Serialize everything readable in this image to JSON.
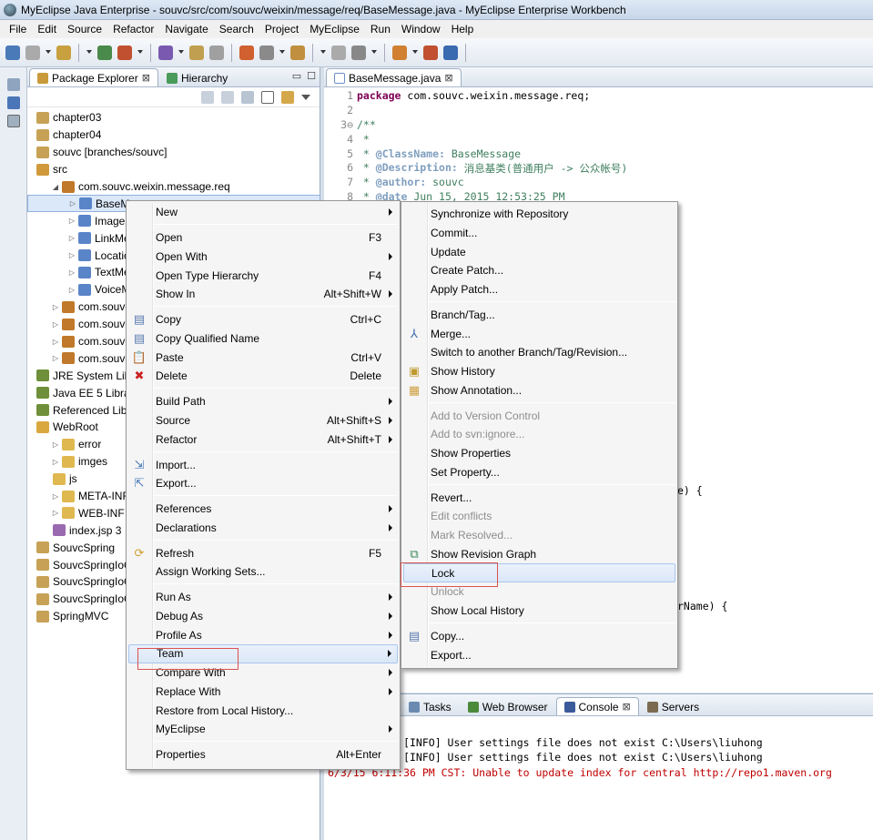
{
  "window": {
    "title": "MyEclipse Java Enterprise - souvc/src/com/souvc/weixin/message/req/BaseMessage.java - MyEclipse Enterprise Workbench"
  },
  "menubar": [
    "File",
    "Edit",
    "Source",
    "Refactor",
    "Navigate",
    "Search",
    "Project",
    "MyEclipse",
    "Run",
    "Window",
    "Help"
  ],
  "views": {
    "package_explorer_tab": "Package Explorer",
    "hierarchy_tab": "Hierarchy",
    "close_glyph": "⊠",
    "minimize_glyph": "▭",
    "maximize_glyph": "☐"
  },
  "tree": [
    {
      "indent": 0,
      "twisty": "",
      "icon": "project",
      "label": "chapter03"
    },
    {
      "indent": 0,
      "twisty": "",
      "icon": "project",
      "label": "chapter04"
    },
    {
      "indent": 0,
      "twisty": "",
      "icon": "project",
      "label": "souvc [branches/souvc]"
    },
    {
      "indent": 0,
      "twisty": "",
      "icon": "src-folder",
      "label": "src"
    },
    {
      "indent": 1,
      "twisty": "◢",
      "icon": "package",
      "label": "com.souvc.weixin.message.req"
    },
    {
      "indent": 2,
      "twisty": "▷",
      "icon": "java-file",
      "label": "BaseMe",
      "selected": true
    },
    {
      "indent": 2,
      "twisty": "▷",
      "icon": "java-file",
      "label": "ImageM"
    },
    {
      "indent": 2,
      "twisty": "▷",
      "icon": "java-file",
      "label": "LinkMes"
    },
    {
      "indent": 2,
      "twisty": "▷",
      "icon": "java-file",
      "label": "Location"
    },
    {
      "indent": 2,
      "twisty": "▷",
      "icon": "java-file",
      "label": "TextMes"
    },
    {
      "indent": 2,
      "twisty": "▷",
      "icon": "java-file",
      "label": "VoiceMe"
    },
    {
      "indent": 1,
      "twisty": "▷",
      "icon": "package",
      "label": "com.souvc.w"
    },
    {
      "indent": 1,
      "twisty": "▷",
      "icon": "package",
      "label": "com.souvc.w"
    },
    {
      "indent": 1,
      "twisty": "▷",
      "icon": "package",
      "label": "com.souvc.w"
    },
    {
      "indent": 1,
      "twisty": "▷",
      "icon": "package",
      "label": "com.souvc.w"
    },
    {
      "indent": 0,
      "twisty": "",
      "icon": "library",
      "label": "JRE System Lib"
    },
    {
      "indent": 0,
      "twisty": "",
      "icon": "library",
      "label": "Java EE 5 Libra"
    },
    {
      "indent": 0,
      "twisty": "",
      "icon": "library",
      "label": "Referenced Lib"
    },
    {
      "indent": 0,
      "twisty": "",
      "icon": "webroot-folder",
      "label": "WebRoot"
    },
    {
      "indent": 1,
      "twisty": "▷",
      "icon": "folder",
      "label": "error"
    },
    {
      "indent": 1,
      "twisty": "▷",
      "icon": "folder",
      "label": "imges"
    },
    {
      "indent": 1,
      "twisty": "",
      "icon": "folder",
      "label": "js"
    },
    {
      "indent": 1,
      "twisty": "▷",
      "icon": "folder",
      "label": "META-INF"
    },
    {
      "indent": 1,
      "twisty": "▷",
      "icon": "folder",
      "label": "WEB-INF"
    },
    {
      "indent": 1,
      "twisty": "",
      "icon": "jsp-file",
      "label": "index.jsp 3"
    },
    {
      "indent": 0,
      "twisty": "",
      "icon": "project",
      "label": "SouvcSpring"
    },
    {
      "indent": 0,
      "twisty": "",
      "icon": "project",
      "label": "SouvcSpringIoC"
    },
    {
      "indent": 0,
      "twisty": "",
      "icon": "project",
      "label": "SouvcSpringIoC_0"
    },
    {
      "indent": 0,
      "twisty": "",
      "icon": "project",
      "label": "SouvcSpringIoC_D"
    },
    {
      "indent": 0,
      "twisty": "",
      "icon": "project",
      "label": "SpringMVC"
    }
  ],
  "editor": {
    "tab": "BaseMessage.java",
    "lines": [
      {
        "n": "1",
        "parts": [
          {
            "c": "kw",
            "t": "package"
          },
          {
            "c": "ct",
            "t": " com.souvc.weixin.message.req;"
          }
        ]
      },
      {
        "n": "2",
        "parts": []
      },
      {
        "n": "3⊖",
        "parts": [
          {
            "c": "cm",
            "t": "/**"
          }
        ]
      },
      {
        "n": "4",
        "parts": [
          {
            "c": "cm",
            "t": " *"
          }
        ]
      },
      {
        "n": "5",
        "parts": [
          {
            "c": "cm",
            "t": " * "
          },
          {
            "c": "tag",
            "t": "@ClassName:"
          },
          {
            "c": "cm",
            "t": " BaseMessage"
          }
        ]
      },
      {
        "n": "6",
        "parts": [
          {
            "c": "cm",
            "t": " * "
          },
          {
            "c": "tag",
            "t": "@Description:"
          },
          {
            "c": "cm",
            "t": " 消息基类(普通用户 -> 公众帐号)"
          }
        ]
      },
      {
        "n": "7",
        "parts": [
          {
            "c": "cm",
            "t": " * "
          },
          {
            "c": "tag",
            "t": "@author:"
          },
          {
            "c": "cm",
            "t": " souvc"
          }
        ]
      },
      {
        "n": "8",
        "parts": [
          {
            "c": "cm",
            "t": " * "
          },
          {
            "c": "tag",
            "t": "@date"
          },
          {
            "c": "cm",
            "t": " Jun 15, 2015 12:53:25 PM"
          }
        ]
      }
    ],
    "fragment_1": "e) {",
    "fragment_2": "rName) {"
  },
  "console": {
    "tabs": [
      "Tasks",
      "Web Browser",
      "Console",
      "Servers"
    ],
    "lines": [
      {
        "type": "info",
        "text": ":32 PM CST: [INFO] User settings file does not exist C:\\Users\\liuhong"
      },
      {
        "type": "info",
        "text": ":33 PM CST: [INFO] User settings file does not exist C:\\Users\\liuhong"
      },
      {
        "type": "err",
        "text": "6/3/15 6:11:36 PM CST: Unable to update index for central http://repo1.maven.org"
      }
    ]
  },
  "context_menu": [
    {
      "label": "New",
      "submenu": true
    },
    {
      "sep": true
    },
    {
      "label": "Open",
      "shortcut": "F3"
    },
    {
      "label": "Open With",
      "submenu": true
    },
    {
      "label": "Open Type Hierarchy",
      "shortcut": "F4"
    },
    {
      "label": "Show In",
      "shortcut": "Alt+Shift+W",
      "submenu": true
    },
    {
      "sep": true
    },
    {
      "label": "Copy",
      "shortcut": "Ctrl+C",
      "icon": "copy-icon"
    },
    {
      "label": "Copy Qualified Name",
      "icon": "copy-qualified-icon"
    },
    {
      "label": "Paste",
      "shortcut": "Ctrl+V",
      "icon": "paste-icon"
    },
    {
      "label": "Delete",
      "shortcut": "Delete",
      "icon": "delete-icon"
    },
    {
      "sep": true
    },
    {
      "label": "Build Path",
      "submenu": true
    },
    {
      "label": "Source",
      "shortcut": "Alt+Shift+S",
      "submenu": true
    },
    {
      "label": "Refactor",
      "shortcut": "Alt+Shift+T",
      "submenu": true
    },
    {
      "sep": true
    },
    {
      "label": "Import...",
      "icon": "import-icon"
    },
    {
      "label": "Export...",
      "icon": "export-icon"
    },
    {
      "sep": true
    },
    {
      "label": "References",
      "submenu": true
    },
    {
      "label": "Declarations",
      "submenu": true
    },
    {
      "sep": true
    },
    {
      "label": "Refresh",
      "shortcut": "F5",
      "icon": "refresh-icon"
    },
    {
      "label": "Assign Working Sets..."
    },
    {
      "sep": true
    },
    {
      "label": "Run As",
      "submenu": true
    },
    {
      "label": "Debug As",
      "submenu": true
    },
    {
      "label": "Profile As",
      "submenu": true
    },
    {
      "label": "Team",
      "submenu": true,
      "hover": true
    },
    {
      "label": "Compare With",
      "submenu": true
    },
    {
      "label": "Replace With",
      "submenu": true
    },
    {
      "label": "Restore from Local History..."
    },
    {
      "label": "MyEclipse",
      "submenu": true
    },
    {
      "sep": true
    },
    {
      "label": "Properties",
      "shortcut": "Alt+Enter"
    }
  ],
  "team_menu": [
    {
      "label": "Synchronize with Repository"
    },
    {
      "label": "Commit..."
    },
    {
      "label": "Update"
    },
    {
      "label": "Create Patch..."
    },
    {
      "label": "Apply Patch..."
    },
    {
      "sep": true
    },
    {
      "label": "Branch/Tag..."
    },
    {
      "label": "Merge...",
      "icon": "merge-icon"
    },
    {
      "label": "Switch to another Branch/Tag/Revision..."
    },
    {
      "label": "Show History",
      "icon": "history-icon"
    },
    {
      "label": "Show Annotation...",
      "icon": "annotation-icon"
    },
    {
      "sep": true
    },
    {
      "label": "Add to Version Control",
      "disabled": true
    },
    {
      "label": "Add to svn:ignore...",
      "disabled": true
    },
    {
      "label": "Show Properties"
    },
    {
      "label": "Set Property..."
    },
    {
      "sep": true
    },
    {
      "label": "Revert..."
    },
    {
      "label": "Edit conflicts",
      "disabled": true
    },
    {
      "label": "Mark Resolved...",
      "disabled": true
    },
    {
      "label": "Show Revision Graph",
      "icon": "revision-graph-icon"
    },
    {
      "label": "Lock",
      "hover": true
    },
    {
      "label": "Unlock",
      "disabled": true
    },
    {
      "label": "Show Local History"
    },
    {
      "sep": true
    },
    {
      "label": "Copy...",
      "icon": "copy-icon"
    },
    {
      "label": "Export..."
    }
  ]
}
